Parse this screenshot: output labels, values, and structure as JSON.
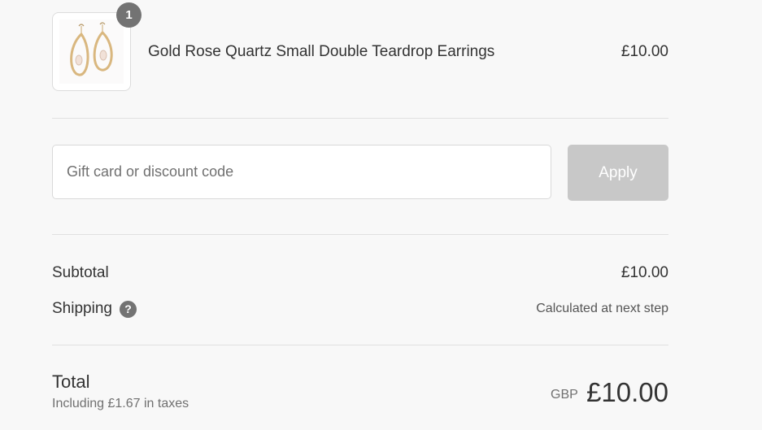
{
  "product": {
    "quantity": "1",
    "name": "Gold Rose Quartz Small Double Teardrop Earrings",
    "price": "£10.00",
    "image_icon": "earrings-image"
  },
  "discount": {
    "placeholder": "Gift card or discount code",
    "value": "",
    "apply_label": "Apply"
  },
  "summary": {
    "subtotal_label": "Subtotal",
    "subtotal_value": "£10.00",
    "shipping_label": "Shipping",
    "shipping_help_icon": "question-icon",
    "shipping_help_glyph": "?",
    "shipping_value": "Calculated at next step"
  },
  "total": {
    "label": "Total",
    "tax_note": "Including £1.67 in taxes",
    "currency": "GBP",
    "amount": "£10.00"
  },
  "colors": {
    "background": "#f8f8f8",
    "badge": "#737373",
    "apply_button_disabled": "#c8c8c8",
    "divider": "#e1e1e1"
  }
}
